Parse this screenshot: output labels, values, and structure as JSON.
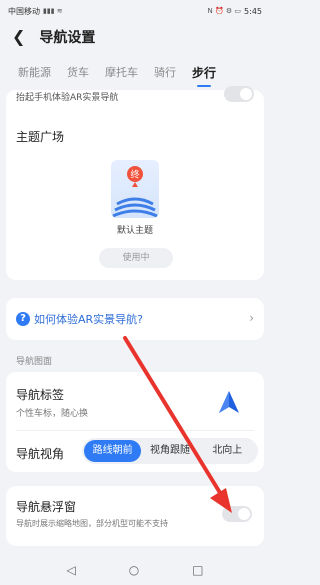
{
  "status_bar": {
    "carrier": "中国移动",
    "right_icons": "N ⏰ ⚙ ▭",
    "time": "5:45"
  },
  "header": {
    "title": "导航设置"
  },
  "tabs": [
    {
      "label": "新能源",
      "active": false
    },
    {
      "label": "货车",
      "active": false
    },
    {
      "label": "摩托车",
      "active": false
    },
    {
      "label": "骑行",
      "active": false
    },
    {
      "label": "步行",
      "active": true
    }
  ],
  "ar_hint": {
    "text": "抬起手机体验AR实景导航",
    "toggle_on": false
  },
  "theme": {
    "title": "主题广场",
    "caption": "默认主题",
    "button": "使用中",
    "badge": "终"
  },
  "ar_link": {
    "text": "如何体验AR实景导航?"
  },
  "section": {
    "label": "导航图面"
  },
  "nav_tag": {
    "title": "导航标签",
    "subtitle": "个性车标，随心换"
  },
  "nav_view": {
    "label": "导航视角",
    "options": [
      "路线朝前",
      "视角跟随",
      "北向上"
    ],
    "selected": "路线朝前"
  },
  "floating": {
    "title": "导航悬浮窗",
    "subtitle": "导航时展示缩略地图，部分机型可能不支持",
    "toggle_on": false
  },
  "colors": {
    "accent": "#2f7bf5",
    "annotation_arrow": "#e8342c"
  }
}
